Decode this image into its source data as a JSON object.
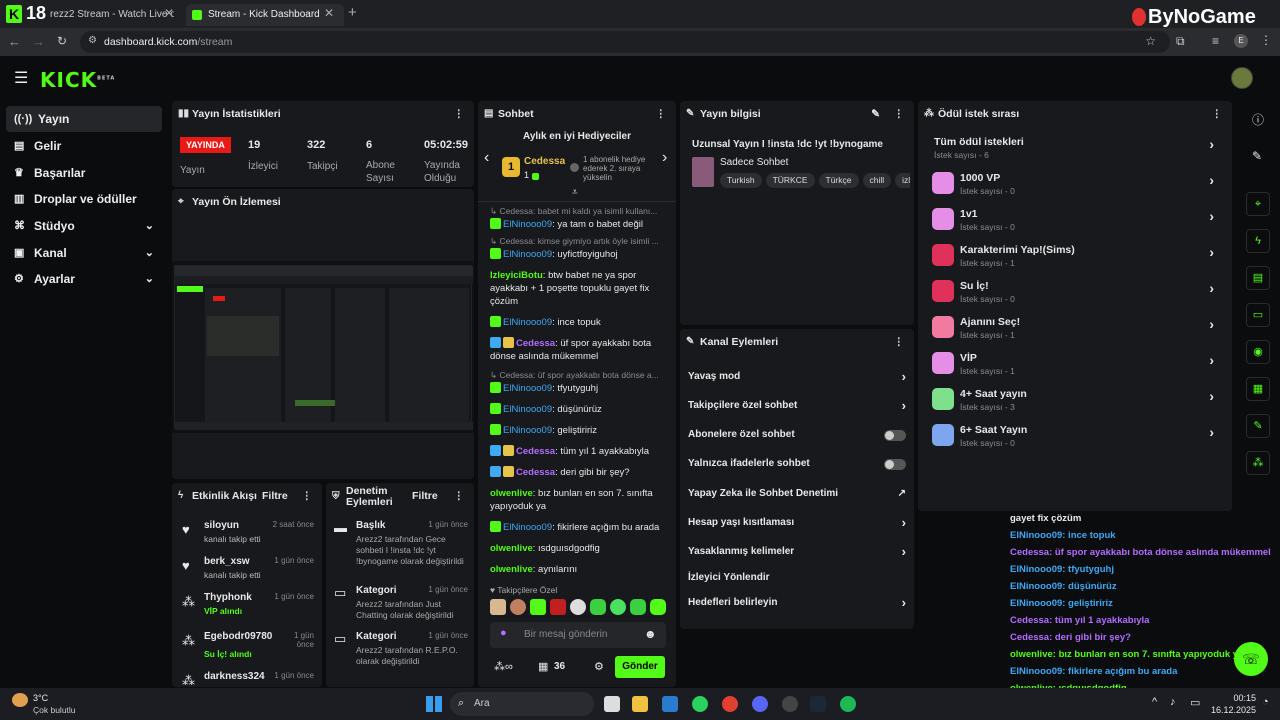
{
  "browser": {
    "badge": "18",
    "tabs": [
      {
        "title": "rezz2 Stream - Watch Live on"
      },
      {
        "title": "Stream - Kick Dashboard"
      }
    ],
    "new_tab": "+",
    "url_host": "dashboard.kick.com",
    "url_path": "/stream",
    "watermark": "ByNoGame",
    "profile": "E"
  },
  "header": {
    "logo": "KICK",
    "logo_sup": "BETA"
  },
  "sidebar": {
    "items": [
      {
        "label": "Yayın",
        "icon": "broadcast-icon"
      },
      {
        "label": "Gelir",
        "icon": "revenue-icon"
      },
      {
        "label": "Başarılar",
        "icon": "trophy-icon"
      },
      {
        "label": "Droplar ve ödüller",
        "icon": "gift-icon"
      },
      {
        "label": "Stüdyo",
        "icon": "studio-icon"
      },
      {
        "label": "Kanal",
        "icon": "channel-icon"
      },
      {
        "label": "Ayarlar",
        "icon": "gear-icon"
      }
    ]
  },
  "stats": {
    "title": "Yayın İstatistikleri",
    "live_badge": "YAYINDA",
    "live_label": "Yayın",
    "viewers": "19",
    "viewers_label": "İzleyici",
    "followers": "322",
    "followers_label": "Takipçi",
    "subs": "6",
    "subs_label": "Abone Sayısı",
    "uptime": "05:02:59",
    "uptime_label": "Yayında Olduğu"
  },
  "preview": {
    "title": "Yayın Ön İzlemesi"
  },
  "chat": {
    "title": "Sohbet",
    "top_gifters": "Aylık en iyi Hediyeciler",
    "gifter_rank": "1",
    "gifter_name": "Cedessa",
    "gifter_count": "1",
    "gifter_hint": "1 abonelik hediye ederek 2. sıraya yükselin",
    "messages": [
      {
        "reply": "Cedessa: babet mi kaldı ya isimli kullanı...",
        "user": "ElNinooo09",
        "text": ": ya tam o babet değil",
        "color": "b"
      },
      {
        "reply": "Cedessa: kimse giymiyo artık öyle isimli ...",
        "user": "ElNinooo09",
        "text": ": uyfictfoyiguhoj",
        "color": "b"
      },
      {
        "user": "IzleyiciBotu",
        "text": ": btw babet ne ya spor ayakkabı + 1 poşette topuklu gayet fix çözüm",
        "color": "g"
      },
      {
        "user": "ElNinooo09",
        "text": ": ince topuk",
        "color": "b"
      },
      {
        "user": "Cedessa",
        "text": ": üf spor ayakkabı bota dönse aslında mükemmel",
        "color": "p"
      },
      {
        "reply": "Cedessa: üf spor ayakkabı bota dönse a...",
        "user": "ElNinooo09",
        "text": ": tfyutyguhj",
        "color": "b"
      },
      {
        "user": "ElNinooo09",
        "text": ": düşünürüz",
        "color": "b"
      },
      {
        "user": "ElNinooo09",
        "text": ": geliştiririz",
        "color": "b"
      },
      {
        "user": "Cedessa",
        "text": ": tüm yıl 1 ayakkabıyla",
        "color": "p"
      },
      {
        "user": "Cedessa",
        "text": ": deri gibi bir şey?",
        "color": "p"
      },
      {
        "user": "olwenlive",
        "text": ": bız bunları en son 7. sınıfta yapıyoduk ya",
        "color": "g"
      },
      {
        "user": "ElNinooo09",
        "text": ": fikirlere açığım bu arada",
        "color": "b"
      },
      {
        "user": "olwenlive",
        "text": ": ısdguısdgodfig",
        "color": "g"
      },
      {
        "user": "olwenlive",
        "text": ": aynılarını",
        "color": "g"
      }
    ],
    "emote_label": "Takipçilere Özel",
    "input_placeholder": "Bir mesaj gönderin",
    "points": "36",
    "send": "Gönder"
  },
  "stream_info": {
    "title": "Yayın bilgisi",
    "stream_title": "Uzunsal Yayın I !insta !dc !yt !bynogame",
    "category": "Sadece Sohbet",
    "tags": [
      "Turkish",
      "TÜRKCE",
      "Türkçe",
      "chill",
      "izle"
    ]
  },
  "channel_actions": {
    "title": "Kanal Eylemleri",
    "items": [
      {
        "label": "Yavaş mod"
      },
      {
        "label": "Takipçilere özel sohbet"
      },
      {
        "label": "Abonelere özel sohbet"
      },
      {
        "label": "Yalnızca ifadelerle sohbet"
      },
      {
        "label": "Yapay Zeka ile Sohbet Denetimi"
      },
      {
        "label": "Hesap yaşı kısıtlaması"
      },
      {
        "label": "Yasaklanmış kelimeler"
      },
      {
        "label": "İzleyici Yönlendir"
      },
      {
        "label": "Hedefleri belirleyin"
      }
    ]
  },
  "rewards": {
    "title": "Ödül istek sırası",
    "all_title": "Tüm ödül istekleri",
    "all_sub": "İstek sayısı - 6",
    "items": [
      {
        "name": "1000 VP",
        "sub": "İstek sayısı - 0",
        "color": "#e58ee8"
      },
      {
        "name": "1v1",
        "sub": "İstek sayısı - 0",
        "color": "#e58ee8"
      },
      {
        "name": "Karakterimi Yap!(Sims)",
        "sub": "İstek sayısı - 1",
        "color": "#e0315a"
      },
      {
        "name": "Su İç!",
        "sub": "İstek sayısı - 0",
        "color": "#e0315a"
      },
      {
        "name": "Ajanını Seç!",
        "sub": "İstek sayısı - 1",
        "color": "#f07aa0"
      },
      {
        "name": "VİP",
        "sub": "İstek sayısı - 1",
        "color": "#e58ee8"
      },
      {
        "name": "4+ Saat yayın",
        "sub": "İstek sayısı - 3",
        "color": "#7ee08a"
      },
      {
        "name": "6+ Saat Yayın",
        "sub": "İstek sayısı - 0",
        "color": "#7ea6f0"
      }
    ]
  },
  "activity": {
    "title": "Etkinlik Akışı",
    "filter": "Filtre",
    "items": [
      {
        "name": "siloyun",
        "sub": "kanalı takip etti",
        "time": "2 saat önce",
        "icon": "heart-icon"
      },
      {
        "name": "berk_xsw",
        "sub": "kanalı takip etti",
        "time": "1 gün önce",
        "icon": "heart-icon"
      },
      {
        "name": "Thyphonk",
        "sub": "VİP alındı",
        "time": "1 gün önce",
        "icon": "reward-icon"
      },
      {
        "name": "Egebodr09780",
        "sub": "Su İç! alındı",
        "time": "1 gün önce",
        "icon": "reward-icon"
      },
      {
        "name": "darkness324",
        "sub": "",
        "time": "1 gün önce",
        "icon": "reward-icon"
      }
    ]
  },
  "moderation": {
    "title": "Denetim Eylemleri",
    "filter": "Filtre",
    "items": [
      {
        "name": "Başlık",
        "time": "1 gün önce",
        "desc": "Arezz2 tarafından Gece sohbeti I !insta !dc !yt !bynogame olarak değiştirildi"
      },
      {
        "name": "Kategori",
        "time": "1 gün önce",
        "desc": "Arezz2 tarafından Just Chatting olarak değiştirildi"
      },
      {
        "name": "Kategori",
        "time": "1 gün önce",
        "desc": "Arezz2 tarafından R.E.P.O. olarak değiştirildi"
      }
    ]
  },
  "overlay_chat": [
    "gayet fix çözüm",
    "ElNinooo09: ince topuk",
    "Cedessa: üf spor ayakkabı bota dönse aslında mükemmel",
    "ElNinooo09: tfyutyguhj",
    "ElNinooo09: düşünürüz",
    "ElNinooo09: geliştiririz",
    "Cedessa: tüm yıl 1 ayakkabıyla",
    "Cedessa: deri gibi bir şey?",
    "olwenlive: bız bunları en son 7. sınıfta yapıyoduk ya",
    "ElNinooo09: fikirlere açığım bu arada",
    "olwenlive: ısdguısdgodfig",
    "olwenlive: aynılarını"
  ],
  "taskbar": {
    "weather_temp": "3°C",
    "weather_desc": "Çok bulutlu",
    "search": "Ara",
    "time": "00:15",
    "date": "16.12.2025"
  }
}
